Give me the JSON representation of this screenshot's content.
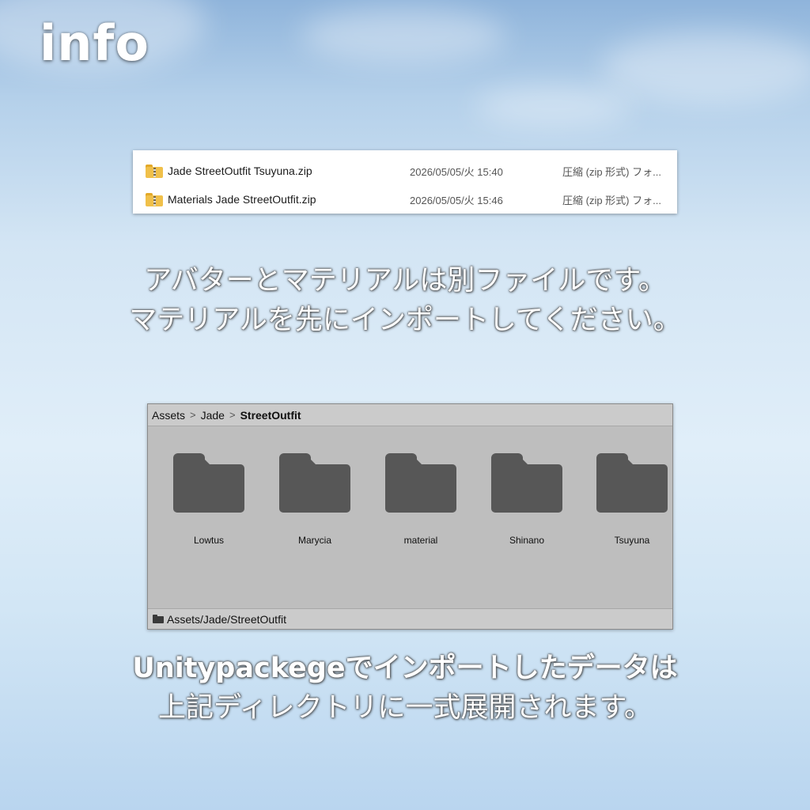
{
  "title": "info",
  "explorer": {
    "files": [
      {
        "name": "Jade StreetOutfit Tsuyuna.zip",
        "date": "2026/05/05/火 15:40",
        "type": "圧縮 (zip 形式) フォ..."
      },
      {
        "name": "Materials Jade StreetOutfit.zip",
        "date": "2026/05/05/火 15:46",
        "type": "圧縮 (zip 形式) フォ..."
      }
    ],
    "icon": "zip-folder-icon"
  },
  "caption1": {
    "line1": "アバターとマテリアルは別ファイルです。",
    "line2": "マテリアルを先にインポートしてください。"
  },
  "unity": {
    "breadcrumb": [
      "Assets",
      "Jade",
      "StreetOutfit"
    ],
    "folders": [
      "Lowtus",
      "Marycia",
      "material",
      "Shinano",
      "Tsuyuna"
    ],
    "status_path": "Assets/Jade/StreetOutfit",
    "folder_color": "#575757"
  },
  "caption2": {
    "line1": "Unitypackegeでインポートしたデータは",
    "line2": "上記ディレクトリに一式展開されます。"
  }
}
